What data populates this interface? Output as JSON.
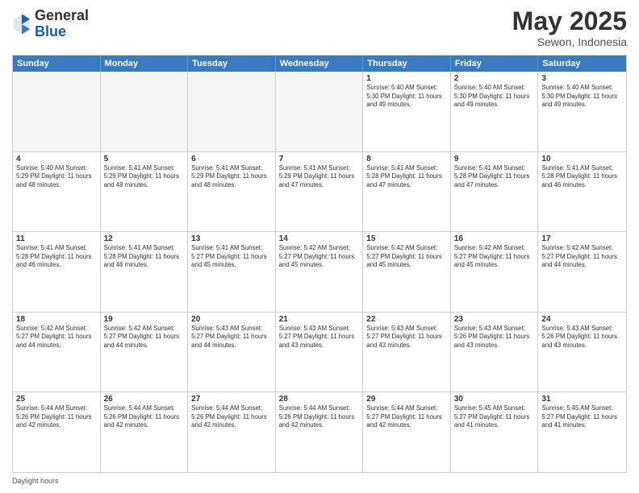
{
  "logo": {
    "general": "General",
    "blue": "Blue"
  },
  "title": "May 2025",
  "location": "Sewon, Indonesia",
  "weekdays": [
    "Sunday",
    "Monday",
    "Tuesday",
    "Wednesday",
    "Thursday",
    "Friday",
    "Saturday"
  ],
  "footer": "Daylight hours",
  "rows": [
    [
      {
        "day": "",
        "info": "",
        "empty": true
      },
      {
        "day": "",
        "info": "",
        "empty": true
      },
      {
        "day": "",
        "info": "",
        "empty": true
      },
      {
        "day": "",
        "info": "",
        "empty": true
      },
      {
        "day": "1",
        "info": "Sunrise: 5:40 AM\nSunset: 5:30 PM\nDaylight: 11 hours\nand 49 minutes.",
        "empty": false
      },
      {
        "day": "2",
        "info": "Sunrise: 5:40 AM\nSunset: 5:30 PM\nDaylight: 11 hours\nand 49 minutes.",
        "empty": false
      },
      {
        "day": "3",
        "info": "Sunrise: 5:40 AM\nSunset: 5:30 PM\nDaylight: 11 hours\nand 49 minutes.",
        "empty": false
      }
    ],
    [
      {
        "day": "4",
        "info": "Sunrise: 5:40 AM\nSunset: 5:29 PM\nDaylight: 11 hours\nand 48 minutes.",
        "empty": false
      },
      {
        "day": "5",
        "info": "Sunrise: 5:41 AM\nSunset: 5:29 PM\nDaylight: 11 hours\nand 48 minutes.",
        "empty": false
      },
      {
        "day": "6",
        "info": "Sunrise: 5:41 AM\nSunset: 5:29 PM\nDaylight: 11 hours\nand 48 minutes.",
        "empty": false
      },
      {
        "day": "7",
        "info": "Sunrise: 5:41 AM\nSunset: 5:29 PM\nDaylight: 11 hours\nand 47 minutes.",
        "empty": false
      },
      {
        "day": "8",
        "info": "Sunrise: 5:41 AM\nSunset: 5:28 PM\nDaylight: 11 hours\nand 47 minutes.",
        "empty": false
      },
      {
        "day": "9",
        "info": "Sunrise: 5:41 AM\nSunset: 5:28 PM\nDaylight: 11 hours\nand 47 minutes.",
        "empty": false
      },
      {
        "day": "10",
        "info": "Sunrise: 5:41 AM\nSunset: 5:28 PM\nDaylight: 11 hours\nand 46 minutes.",
        "empty": false
      }
    ],
    [
      {
        "day": "11",
        "info": "Sunrise: 5:41 AM\nSunset: 5:28 PM\nDaylight: 11 hours\nand 46 minutes.",
        "empty": false
      },
      {
        "day": "12",
        "info": "Sunrise: 5:41 AM\nSunset: 5:28 PM\nDaylight: 11 hours\nand 46 minutes.",
        "empty": false
      },
      {
        "day": "13",
        "info": "Sunrise: 5:41 AM\nSunset: 5:27 PM\nDaylight: 11 hours\nand 45 minutes.",
        "empty": false
      },
      {
        "day": "14",
        "info": "Sunrise: 5:42 AM\nSunset: 5:27 PM\nDaylight: 11 hours\nand 45 minutes.",
        "empty": false
      },
      {
        "day": "15",
        "info": "Sunrise: 5:42 AM\nSunset: 5:27 PM\nDaylight: 11 hours\nand 45 minutes.",
        "empty": false
      },
      {
        "day": "16",
        "info": "Sunrise: 5:42 AM\nSunset: 5:27 PM\nDaylight: 11 hours\nand 45 minutes.",
        "empty": false
      },
      {
        "day": "17",
        "info": "Sunrise: 5:42 AM\nSunset: 5:27 PM\nDaylight: 11 hours\nand 44 minutes.",
        "empty": false
      }
    ],
    [
      {
        "day": "18",
        "info": "Sunrise: 5:42 AM\nSunset: 5:27 PM\nDaylight: 11 hours\nand 44 minutes.",
        "empty": false
      },
      {
        "day": "19",
        "info": "Sunrise: 5:42 AM\nSunset: 5:27 PM\nDaylight: 11 hours\nand 44 minutes.",
        "empty": false
      },
      {
        "day": "20",
        "info": "Sunrise: 5:43 AM\nSunset: 5:27 PM\nDaylight: 11 hours\nand 44 minutes.",
        "empty": false
      },
      {
        "day": "21",
        "info": "Sunrise: 5:43 AM\nSunset: 5:27 PM\nDaylight: 11 hours\nand 43 minutes.",
        "empty": false
      },
      {
        "day": "22",
        "info": "Sunrise: 5:43 AM\nSunset: 5:27 PM\nDaylight: 11 hours\nand 43 minutes.",
        "empty": false
      },
      {
        "day": "23",
        "info": "Sunrise: 5:43 AM\nSunset: 5:26 PM\nDaylight: 11 hours\nand 43 minutes.",
        "empty": false
      },
      {
        "day": "24",
        "info": "Sunrise: 5:43 AM\nSunset: 5:26 PM\nDaylight: 11 hours\nand 43 minutes.",
        "empty": false
      }
    ],
    [
      {
        "day": "25",
        "info": "Sunrise: 5:44 AM\nSunset: 5:26 PM\nDaylight: 11 hours\nand 42 minutes.",
        "empty": false
      },
      {
        "day": "26",
        "info": "Sunrise: 5:44 AM\nSunset: 5:26 PM\nDaylight: 11 hours\nand 42 minutes.",
        "empty": false
      },
      {
        "day": "27",
        "info": "Sunrise: 5:44 AM\nSunset: 5:26 PM\nDaylight: 11 hours\nand 42 minutes.",
        "empty": false
      },
      {
        "day": "28",
        "info": "Sunrise: 5:44 AM\nSunset: 5:26 PM\nDaylight: 11 hours\nand 42 minutes.",
        "empty": false
      },
      {
        "day": "29",
        "info": "Sunrise: 5:44 AM\nSunset: 5:27 PM\nDaylight: 11 hours\nand 42 minutes.",
        "empty": false
      },
      {
        "day": "30",
        "info": "Sunrise: 5:45 AM\nSunset: 5:27 PM\nDaylight: 11 hours\nand 41 minutes.",
        "empty": false
      },
      {
        "day": "31",
        "info": "Sunrise: 5:45 AM\nSunset: 5:27 PM\nDaylight: 11 hours\nand 41 minutes.",
        "empty": false
      }
    ]
  ]
}
